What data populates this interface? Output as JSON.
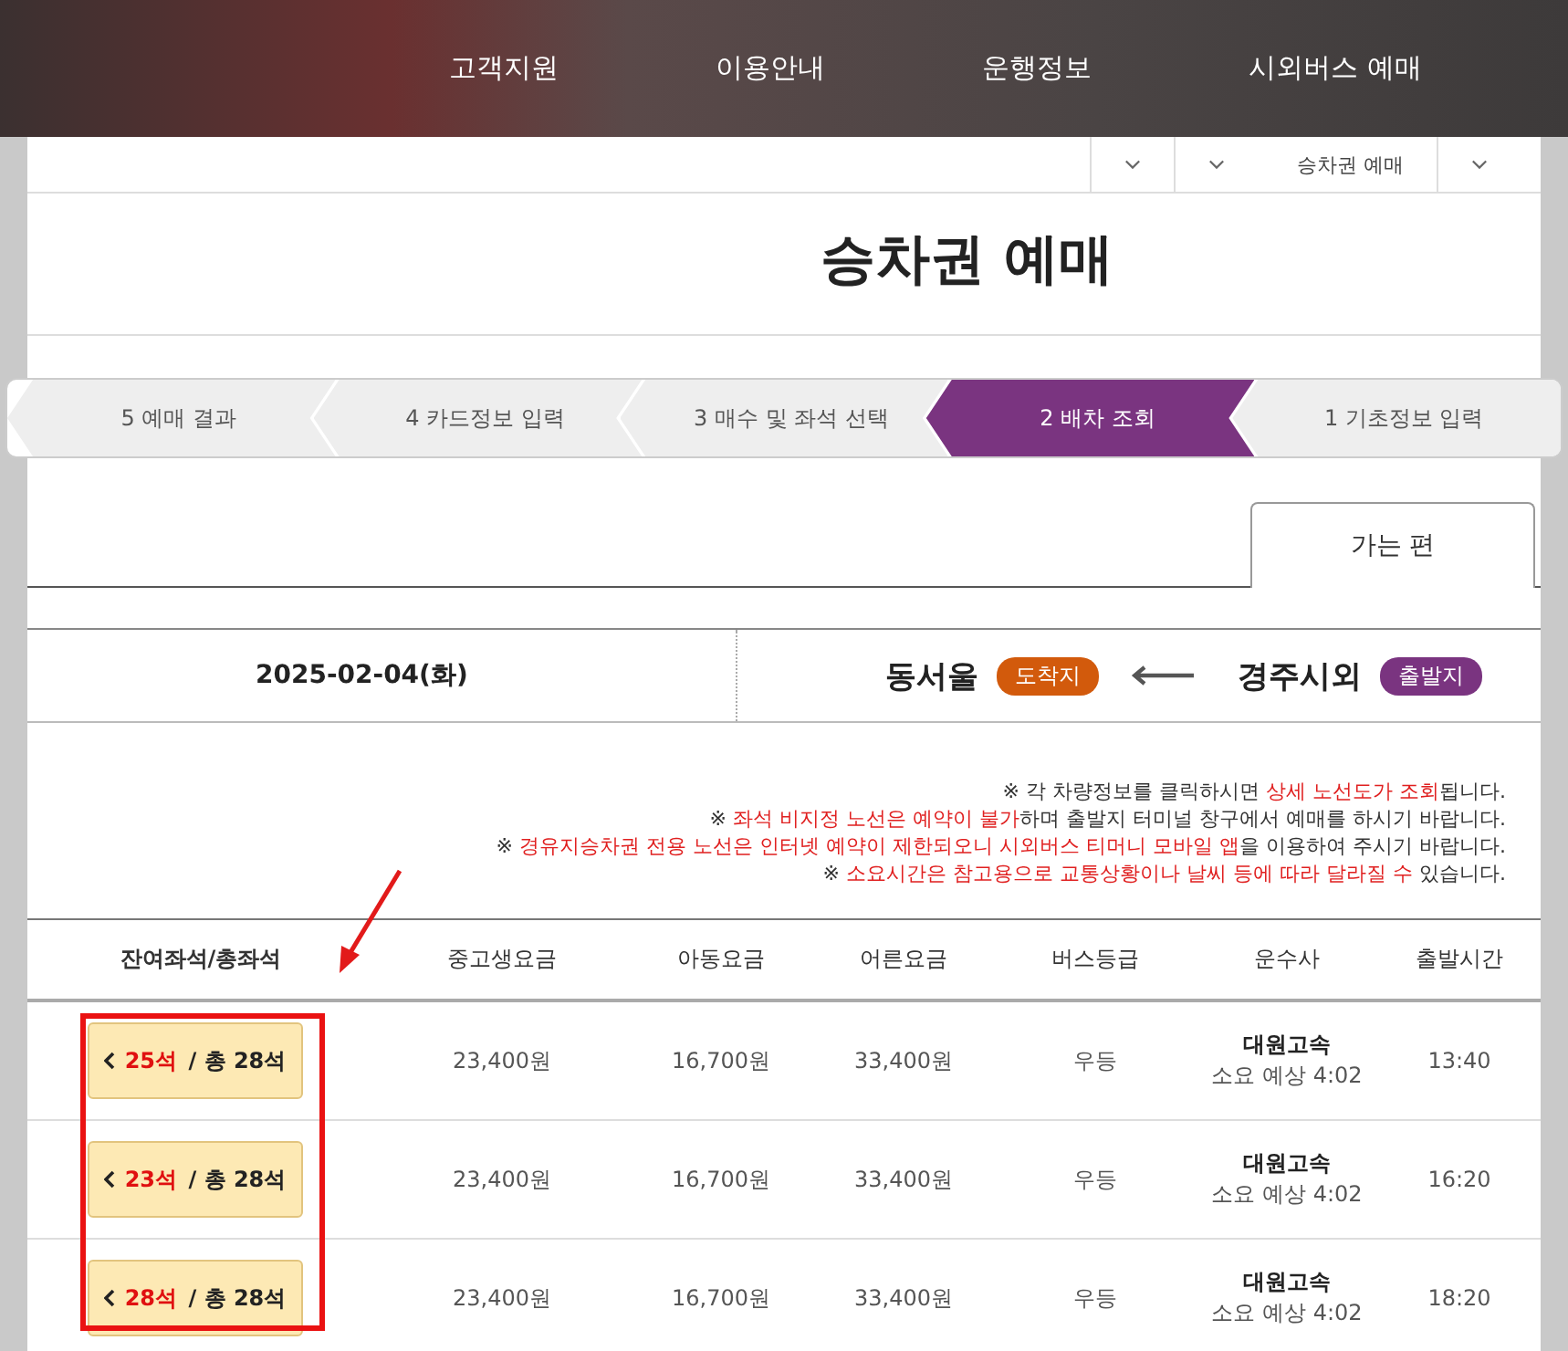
{
  "nav": [
    "고객지원",
    "이용안내",
    "운행정보",
    "시외버스 예매"
  ],
  "breadcrumb": [
    "승차권 예매"
  ],
  "title": "승차권 예매",
  "steps": [
    {
      "label": "5 예매 결과",
      "selected": false
    },
    {
      "label": "4 카드정보 입력",
      "selected": false
    },
    {
      "label": "3 매수 및 좌석 선택",
      "selected": false
    },
    {
      "label": "2 배차 조회",
      "selected": true
    },
    {
      "label": "1 기초정보 입력",
      "selected": false
    }
  ],
  "tabs": [
    {
      "label": "가는 편",
      "selected": true
    }
  ],
  "route": {
    "date": "2025-02-04(화)",
    "arrival": "동서울",
    "arrival_badge": "도착지",
    "departure": "경주시외",
    "departure_badge": "출발지"
  },
  "notes": [
    [
      {
        "text": "※ 각 차량정보를 클릭하시면 ",
        "emphasis": false
      },
      {
        "text": "상세 노선도가 조회",
        "emphasis": true
      },
      {
        "text": "됩니다.",
        "emphasis": false
      }
    ],
    [
      {
        "text": "※ ",
        "emphasis": false
      },
      {
        "text": "좌석 비지정 노선은 예약이 불가",
        "emphasis": true
      },
      {
        "text": "하며 출발지 터미널 창구에서 예매를 하시기 바랍니다.",
        "emphasis": false
      }
    ],
    [
      {
        "text": "※ ",
        "emphasis": false
      },
      {
        "text": "경유지승차권 전용 노선은 인터넷 예약이 제한되오니 시외버스 티머니 모바일 앱",
        "emphasis": true
      },
      {
        "text": "을 이용하여 주시기 바랍니다.",
        "emphasis": false
      }
    ],
    [
      {
        "text": "※ ",
        "emphasis": false
      },
      {
        "text": "소요시간은 참고용으로 교통상황이나 날씨 등에 따라 달라질 수",
        "emphasis": true
      },
      {
        "text": " 있습니다.",
        "emphasis": false
      }
    ]
  ],
  "table": {
    "columns": [
      "잔여좌석/총좌석",
      "중고생요금",
      "아동요금",
      "어른요금",
      "버스등급",
      "운수사",
      "출발시간"
    ],
    "rows": [
      {
        "remaining": "25석",
        "total": "/ 총 28석",
        "youth": "23,400원",
        "child": "16,700원",
        "adult": "33,400원",
        "grade": "우등",
        "company": "대원고속",
        "duration": "소요 예상 4:02",
        "time": "13:40"
      },
      {
        "remaining": "23석",
        "total": "/ 총 28석",
        "youth": "23,400원",
        "child": "16,700원",
        "adult": "33,400원",
        "grade": "우등",
        "company": "대원고속",
        "duration": "소요 예상 4:02",
        "time": "16:20"
      },
      {
        "remaining": "28석",
        "total": "/ 총 28석",
        "youth": "23,400원",
        "child": "16,700원",
        "adult": "33,400원",
        "grade": "우등",
        "company": "대원고속",
        "duration": "소요 예상 4:02",
        "time": "18:20"
      }
    ]
  }
}
